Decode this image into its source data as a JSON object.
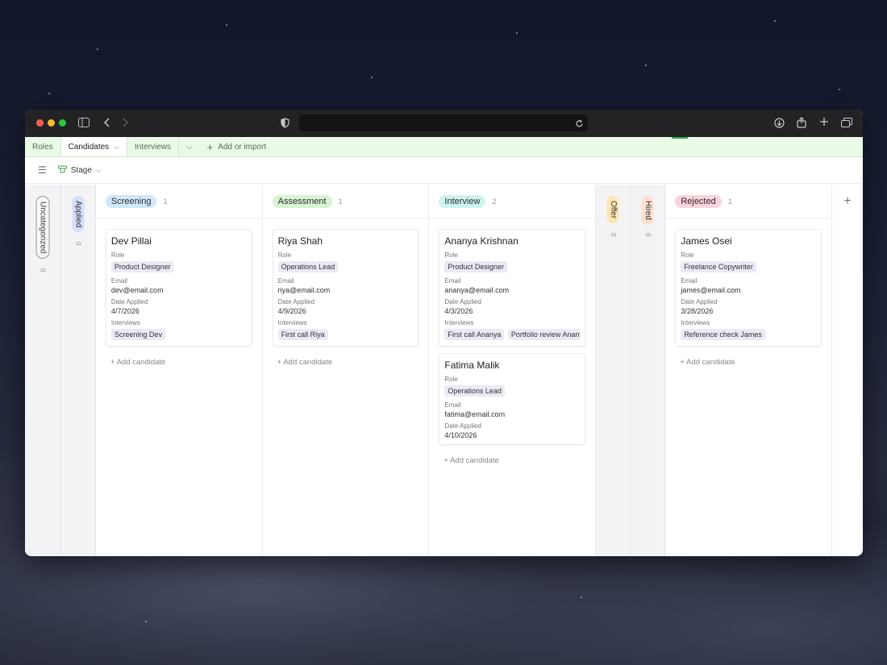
{
  "browser": {
    "back_icon": "chevron-left-icon",
    "forward_icon": "chevron-right-icon",
    "url": ""
  },
  "tabs": [
    {
      "label": "Roles"
    },
    {
      "label": "Candidates"
    },
    {
      "label": "Interviews"
    }
  ],
  "add_or_import": "Add or import",
  "toolbar": {
    "group_label": "Stage"
  },
  "field_labels": {
    "role": "Role",
    "email": "Email",
    "date": "Date Applied",
    "interviews": "Interviews"
  },
  "add_candidate": "Add candidate",
  "collapsed": {
    "uncategorized": {
      "label": "Uncategorized",
      "count": "0"
    },
    "applied": {
      "label": "Applied",
      "count": "0"
    },
    "offer": {
      "label": "Offer",
      "count": "0"
    },
    "hired": {
      "label": "Hired",
      "count": "0"
    }
  },
  "columns": {
    "screening": {
      "label": "Screening",
      "count": "1",
      "color": "#cfe8fb",
      "cards": [
        {
          "name": "Dev Pillai",
          "role": "Product Designer",
          "email": "dev@email.com",
          "date": "4/7/2026",
          "interviews": [
            "Screening Dev"
          ]
        }
      ]
    },
    "assessment": {
      "label": "Assessment",
      "count": "1",
      "color": "#d7f5d2",
      "cards": [
        {
          "name": "Riya Shah",
          "role": "Operations Lead",
          "email": "riya@email.com",
          "date": "4/9/2026",
          "interviews": [
            "First call Riya"
          ]
        }
      ]
    },
    "interview": {
      "label": "Interview",
      "count": "2",
      "color": "#cdf3ee",
      "cards": [
        {
          "name": "Ananya Krishnan",
          "role": "Product Designer",
          "email": "ananya@email.com",
          "date": "4/3/2026",
          "interviews": [
            "First call Ananya",
            "Portfolio review Ananya"
          ]
        },
        {
          "name": "Fatima Malik",
          "role": "Operations Lead",
          "email": "fatima@email.com",
          "date": "4/10/2026"
        }
      ]
    },
    "rejected": {
      "label": "Rejected",
      "count": "1",
      "color": "#fbd3dc",
      "cards": [
        {
          "name": "James Osei",
          "role": "Freelance Copywriter",
          "email": "james@email.com",
          "date": "3/28/2026",
          "interviews": [
            "Reference check James"
          ]
        }
      ]
    }
  }
}
